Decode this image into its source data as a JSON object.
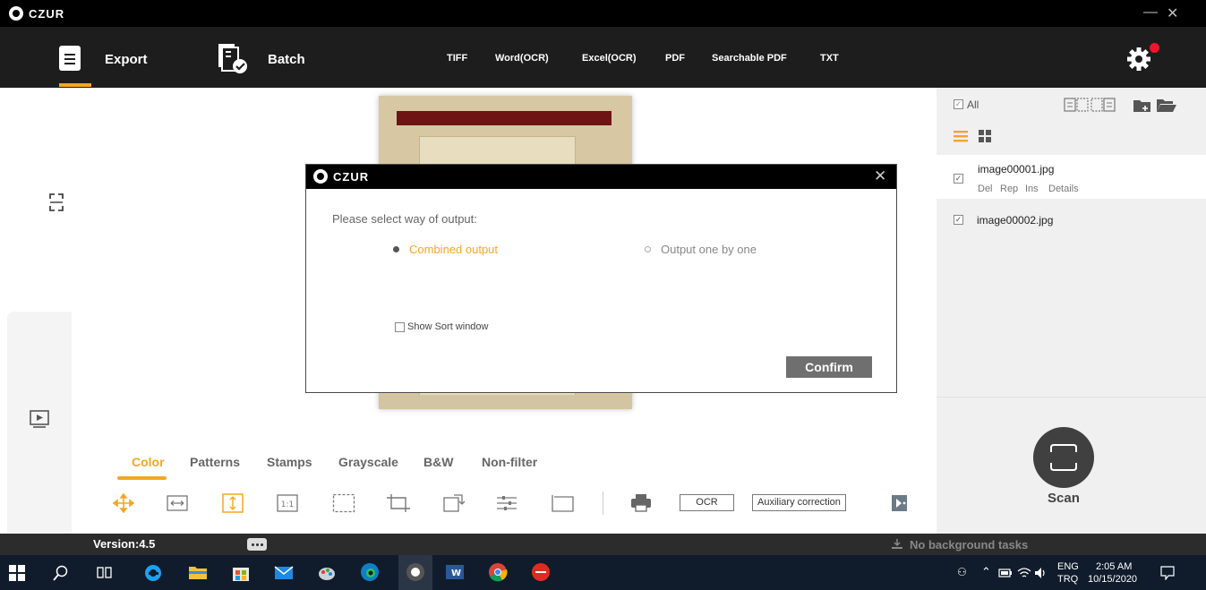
{
  "app": {
    "brand": "CZUR",
    "minimize": "—",
    "close": "✕"
  },
  "toolbar": {
    "export_label": "Export",
    "batch_label": "Batch",
    "formats": [
      "TIFF",
      "Word(OCR)",
      "Excel(OCR)",
      "PDF",
      "Searchable PDF",
      "TXT"
    ]
  },
  "dialog": {
    "brand": "CZUR",
    "close": "✕",
    "prompt": "Please select way of output:",
    "options": [
      {
        "label": "Combined output",
        "selected": true
      },
      {
        "label": "Output one by one",
        "selected": false
      }
    ],
    "show_sort_label": "Show Sort window",
    "confirm_label": "Confirm"
  },
  "filters": {
    "active": "Color",
    "items": [
      "Color",
      "Patterns",
      "Stamps",
      "Grayscale",
      "B&W",
      "Non-filter"
    ]
  },
  "tools": {
    "ocr_label": "OCR",
    "aux_label": "Auxiliary correction"
  },
  "right_panel": {
    "all_label": "All",
    "check_glyph": "✓",
    "files": [
      {
        "name": "image00001.jpg",
        "actions": [
          "Del",
          "Rep",
          "Ins",
          "Details"
        ]
      },
      {
        "name": "image00002.jpg",
        "actions": []
      }
    ],
    "scan_label": "Scan"
  },
  "status": {
    "version": "Version:4.5",
    "background_tasks": "No background tasks"
  },
  "taskbar": {
    "lang_top": "ENG",
    "lang_bottom": "TRQ",
    "time": "2:05 AM",
    "date": "10/15/2020"
  },
  "colors": {
    "accent": "#f5a623",
    "toolbar": "#1d1d1d",
    "notification": "#f0142a"
  }
}
